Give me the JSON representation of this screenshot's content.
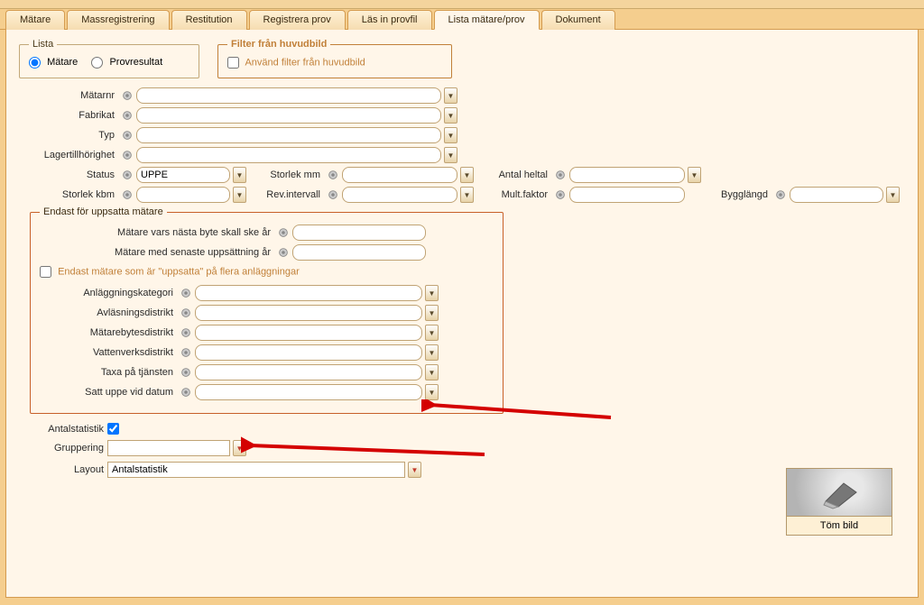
{
  "tabs": [
    {
      "label": "Mätare"
    },
    {
      "label": "Massregistrering"
    },
    {
      "label": "Restitution"
    },
    {
      "label": "Registrera prov"
    },
    {
      "label": "Läs in provfil"
    },
    {
      "label": "Lista mätare/prov"
    },
    {
      "label": "Dokument"
    }
  ],
  "activeTab": 5,
  "lista": {
    "legend": "Lista",
    "options": [
      {
        "label": "Mätare",
        "checked": true
      },
      {
        "label": "Provresultat",
        "checked": false
      }
    ]
  },
  "filter": {
    "legend": "Filter från huvudbild",
    "checkbox": "Använd filter från huvudbild"
  },
  "formTop": {
    "matarnr": "Mätarnr",
    "fabrikat": "Fabrikat",
    "typ": "Typ",
    "lager": "Lagertillhörighet",
    "status": "Status",
    "status_value": "UPPE",
    "storlek_kbm": "Storlek kbm",
    "storlek_mm": "Storlek mm",
    "rev_intervall": "Rev.intervall",
    "antal_heltal": "Antal heltal",
    "mult_faktor": "Mult.faktor",
    "bygglangd": "Bygglängd"
  },
  "endast": {
    "legend": "Endast för uppsatta mätare",
    "byte_ar": "Mätare vars nästa byte skall ske år",
    "senaste_upps": "Mätare med senaste uppsättning år",
    "flera": "Endast mätare som är \"uppsatta\" på flera anläggningar",
    "rows": [
      {
        "label": "Anläggningskategori"
      },
      {
        "label": "Avläsningsdistrikt"
      },
      {
        "label": "Mätarebytesdistrikt"
      },
      {
        "label": "Vattenverksdistrikt"
      },
      {
        "label": "Taxa på tjänsten"
      },
      {
        "label": "Satt uppe vid datum"
      }
    ]
  },
  "bottom": {
    "antalstatistik": "Antalstatistik",
    "gruppering": "Gruppering",
    "layout": "Layout",
    "layout_value": "Antalstatistik"
  },
  "tom_bild": "Töm bild"
}
